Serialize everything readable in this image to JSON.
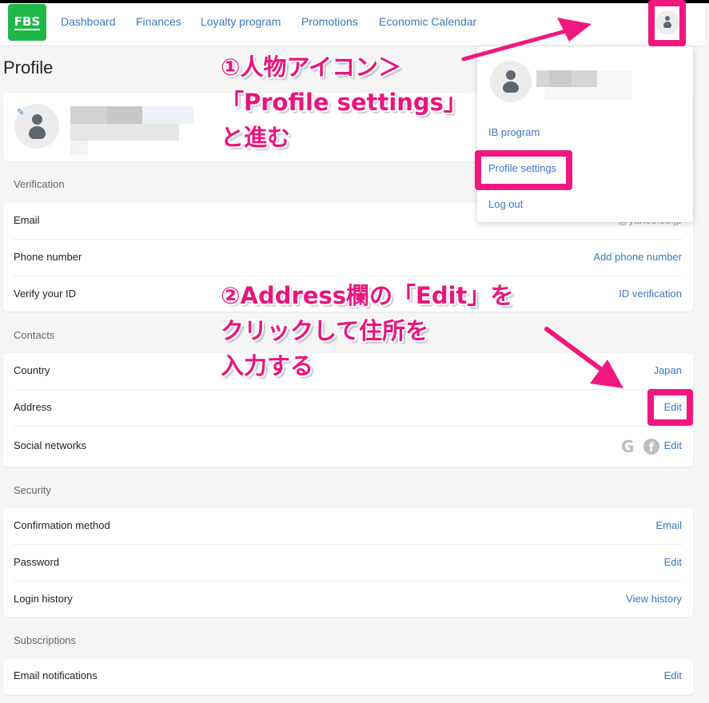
{
  "header": {
    "logo": "FBS",
    "nav": [
      "Dashboard",
      "Finances",
      "Loyalty program",
      "Promotions",
      "Economic Calendar"
    ]
  },
  "page_title": "Profile",
  "user_menu": {
    "items": [
      "IB program",
      "Profile settings",
      "Log out"
    ]
  },
  "sections": {
    "verification": {
      "title": "Verification",
      "rows": [
        {
          "label": "Email",
          "value": "•••••••••••@yahoo.co.jp"
        },
        {
          "label": "Phone number",
          "value": "Add phone number"
        },
        {
          "label": "Verify your ID",
          "value": "ID verification"
        }
      ]
    },
    "contacts": {
      "title": "Contacts",
      "rows": [
        {
          "label": "Country",
          "value": "Japan"
        },
        {
          "label": "Address",
          "value": "Edit"
        },
        {
          "label": "Social networks",
          "value": "Edit",
          "icons": [
            "google-icon",
            "facebook-icon"
          ]
        }
      ]
    },
    "security": {
      "title": "Security",
      "rows": [
        {
          "label": "Confirmation method",
          "value": "Email"
        },
        {
          "label": "Password",
          "value": "Edit"
        },
        {
          "label": "Login history",
          "value": "View history"
        }
      ]
    },
    "subscriptions": {
      "title": "Subscriptions",
      "rows": [
        {
          "label": "Email notifications",
          "value": "Edit"
        }
      ]
    }
  },
  "annotations": {
    "step1": [
      "①人物アイコン＞",
      "「Profile settings」",
      "と進む"
    ],
    "step2": [
      "②Address欄の「Edit」を",
      "クリックして住所を",
      "入力する"
    ]
  },
  "colors": {
    "brand_green": "#1eb84a",
    "link_blue": "#3a78c0",
    "annotation_pink": "#f0187f"
  }
}
